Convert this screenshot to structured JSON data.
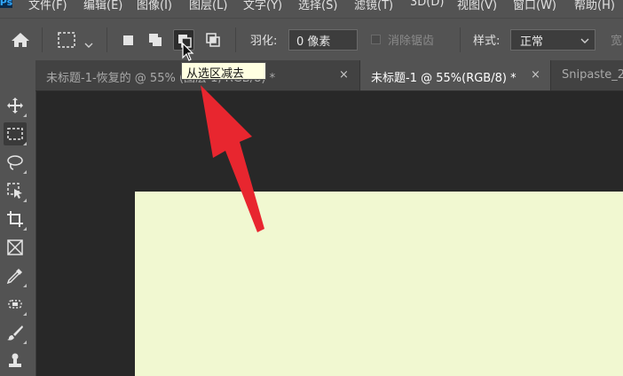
{
  "menubar": {
    "logo": "Ps",
    "items": [
      {
        "label": "文件(F)"
      },
      {
        "label": "编辑(E)"
      },
      {
        "label": "图像(I)"
      },
      {
        "label": "图层(L)"
      },
      {
        "label": "文字(Y)"
      },
      {
        "label": "选择(S)"
      },
      {
        "label": "滤镜(T)"
      },
      {
        "label": "3D(D)"
      },
      {
        "label": "视图(V)"
      },
      {
        "label": "窗口(W)"
      },
      {
        "label": "帮助(H)"
      }
    ]
  },
  "options": {
    "icons": [
      "home-icon",
      "rect-marquee-icon",
      "chevron-down-icon",
      "new-selection-icon",
      "add-to-selection-icon",
      "subtract-from-selection-icon",
      "intersect-selection-icon"
    ],
    "feather_label": "羽化:",
    "feather_value": "0 像素",
    "antialias_label": "消除锯齿",
    "style_label": "样式:",
    "style_value": "正常",
    "width_label": "宽"
  },
  "tabs": [
    {
      "label": "未标题-1-恢复的 @ 55% (图层 1, RGB/8) *",
      "close": "×",
      "active": false
    },
    {
      "label": "未标题-1 @ 55%(RGB/8) *",
      "close": "×",
      "active": true
    },
    {
      "label": "Snipaste_2",
      "close": "",
      "active": false
    }
  ],
  "tooltip": {
    "text": "从选区减去"
  },
  "tools": [
    "move-icon",
    "rect-marquee-icon",
    "lasso-icon",
    "object-select-icon",
    "crop-icon",
    "frame-icon",
    "eyedropper-icon",
    "healing-icon",
    "brush-icon",
    "stamp-icon"
  ],
  "colors": {
    "menubar_bg": "#535353",
    "canvas_bg": "#282828",
    "document_fill": "#f1f8d1",
    "annotation_arrow": "#e8262f",
    "tooltip_bg": "#ffffe1"
  }
}
